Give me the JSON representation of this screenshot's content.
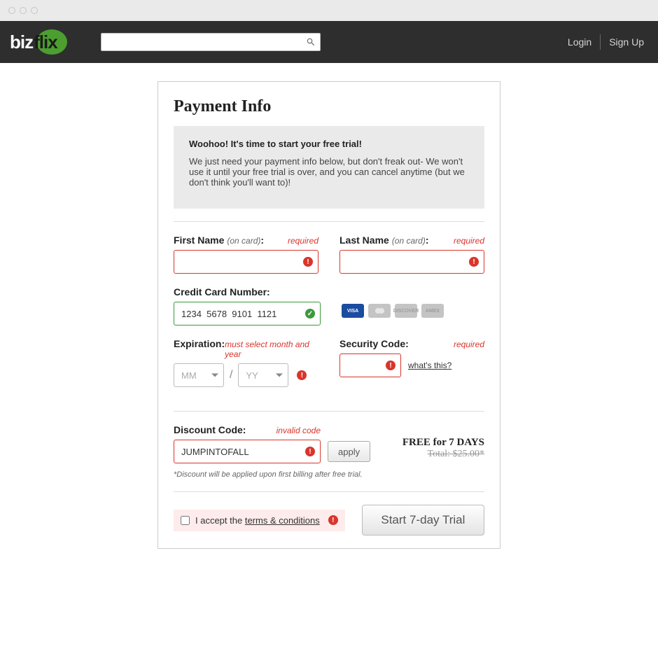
{
  "nav": {
    "brand_prefix": "biz",
    "brand_suffix": "flix",
    "login": "Login",
    "signup": "Sign Up",
    "search_placeholder": ""
  },
  "page": {
    "title": "Payment Info",
    "intro_heading": "Woohoo! It's time to start your free trial!",
    "intro_body": "We just need your payment info below, but don't freak out- We won't use it until your free trial is over, and you can cancel anytime (but we don't think you'll want to)!"
  },
  "fields": {
    "first_name": {
      "label": "First Name",
      "hint": "(on card)",
      "colon": ":",
      "req": "required",
      "value": ""
    },
    "last_name": {
      "label": "Last Name",
      "hint": "(on card)",
      "colon": ":",
      "req": "required",
      "value": ""
    },
    "cc": {
      "label": "Credit Card Number:",
      "value": "1234  5678  9101  1121"
    },
    "expiration": {
      "label": "Expiration:",
      "err": "must select month and year",
      "mm_placeholder": "MM",
      "yy_placeholder": "YY"
    },
    "security": {
      "label": "Security Code:",
      "req": "required",
      "whats_this": "what's this?",
      "value": ""
    },
    "discount": {
      "label": "Discount Code:",
      "err": "invalid code",
      "value": "JUMPINTOFALL",
      "apply": "apply",
      "note": "*Discount will be applied upon first billing after free trial."
    },
    "price": {
      "free": "FREE for 7 DAYS",
      "total": "Total: $25.00*"
    },
    "terms": {
      "prefix": "I accept the ",
      "link": "terms & conditions"
    },
    "cta": "Start 7-day Trial"
  },
  "cards": [
    "VISA",
    "mc",
    "DISCOVER",
    "AMEX"
  ],
  "slash": "/"
}
